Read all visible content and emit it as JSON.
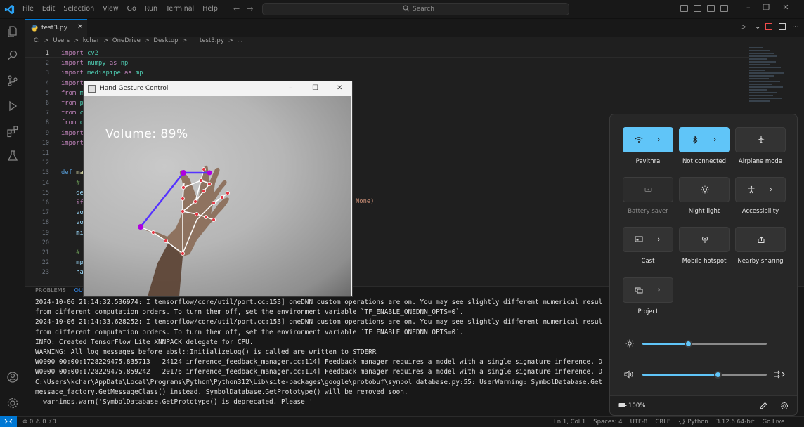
{
  "menu": [
    "File",
    "Edit",
    "Selection",
    "View",
    "Go",
    "Run",
    "Terminal",
    "Help"
  ],
  "search": {
    "label": "Search"
  },
  "tab": {
    "filename": "test3.py"
  },
  "breadcrumb": [
    "C:",
    ">",
    "Users",
    ">",
    "kchar",
    ">",
    "OneDrive",
    ">",
    "Desktop",
    ">",
    "test3.py",
    ">",
    "..."
  ],
  "code": {
    "line_numbers": [
      "1",
      "2",
      "3",
      "4",
      "5",
      "6",
      "7",
      "8",
      "9",
      "10",
      "11",
      "12",
      "13",
      "14",
      "15",
      "16",
      "17",
      "18",
      "19",
      "20",
      "21",
      "22",
      "23"
    ],
    "l1_kw": "import",
    "l1_mod": "cv2",
    "l2_kw": "import",
    "l2_mod": "numpy",
    "l2_as": "as",
    "l2_alias": "np",
    "l3_kw": "import",
    "l3_mod": "mediapipe",
    "l3_as": "as",
    "l3_alias": "mp",
    "l4_kw": "import",
    "l5_kw": "from",
    "l5_rest": "m",
    "l6_kw": "from",
    "l6_rest": "p",
    "l7_kw": "from",
    "l7_rest": "c",
    "l8_kw": "from",
    "l8_rest": "c",
    "l9_kw": "import",
    "l10_kw": "import",
    "l12_kw": "def",
    "l12_rest": "ma",
    "l13": "#",
    "l14": "de",
    "l15": "if",
    "l16": "vo",
    "l17": "vo",
    "l18": "mi",
    "l20": "#",
    "l21": "mp",
    "l22": "ha",
    "tail": "None)"
  },
  "panel": {
    "tabs": [
      "PROBLEMS",
      "OU"
    ]
  },
  "terminal": [
    "2024-10-06 21:14:32.536974: I tensorflow/core/util/port.cc:153] oneDNN custom operations are on. You may see slightly different numerical resul",
    "from different computation orders. To turn them off, set the environment variable `TF_ENABLE_ONEDNN_OPTS=0`.",
    "2024-10-06 21:14:33.628252: I tensorflow/core/util/port.cc:153] oneDNN custom operations are on. You may see slightly different numerical resul",
    "from different computation orders. To turn them off, set the environment variable `TF_ENABLE_ONEDNN_OPTS=0`.",
    "INFO: Created TensorFlow Lite XNNPACK delegate for CPU.",
    "WARNING: All log messages before absl::InitializeLog() is called are written to STDERR",
    "W0000 00:00:1728229475.835713   24124 inference_feedback_manager.cc:114] Feedback manager requires a model with a single signature inference. D",
    "W0000 00:00:1728229475.859242   20176 inference_feedback_manager.cc:114] Feedback manager requires a model with a single signature inference. D",
    "C:\\Users\\kchar\\AppData\\Local\\Programs\\Python\\Python312\\Lib\\site-packages\\google\\protobuf\\symbol_database.py:55: UserWarning: SymbolDatabase.Get",
    "message_factory.GetMessageClass() instead. SymbolDatabase.GetPrototype() will be removed soon.",
    "  warnings.warn('SymbolDatabase.GetPrototype() is deprecated. Please '"
  ],
  "camera_window": {
    "title": "Hand Gesture Control",
    "volume_text": "Volume:  89%"
  },
  "quick_settings": {
    "tiles": [
      {
        "label": "Pavithra",
        "on": true,
        "icon": "wifi-icon",
        "chevron": true
      },
      {
        "label": "Not connected",
        "on": true,
        "icon": "bluetooth-icon",
        "chevron": true
      },
      {
        "label": "Airplane mode",
        "on": false,
        "icon": "airplane-icon",
        "chevron": false
      },
      {
        "label": "Battery saver",
        "on": false,
        "icon": "battery-saver-icon",
        "chevron": false,
        "disabled": true
      },
      {
        "label": "Night light",
        "on": false,
        "icon": "night-light-icon",
        "chevron": false
      },
      {
        "label": "Accessibility",
        "on": false,
        "icon": "accessibility-icon",
        "chevron": true
      },
      {
        "label": "Cast",
        "on": false,
        "icon": "cast-icon",
        "chevron": true
      },
      {
        "label": "Mobile hotspot",
        "on": false,
        "icon": "hotspot-icon",
        "chevron": false
      },
      {
        "label": "Nearby sharing",
        "on": false,
        "icon": "nearby-share-icon",
        "chevron": false
      },
      {
        "label": "Project",
        "on": false,
        "icon": "project-icon",
        "chevron": true
      }
    ],
    "brightness_level": 0.37,
    "volume_level": 0.61,
    "battery": "100%",
    "accent": "#60c5f8"
  },
  "status": {
    "left": "⊗ 0 ⚠ 0   ⚡0",
    "right": [
      "Ln 1, Col 1",
      "Spaces: 4",
      "UTF-8",
      "CRLF",
      "{} Python",
      "3.12.6 64-bit",
      "Go Live"
    ]
  }
}
